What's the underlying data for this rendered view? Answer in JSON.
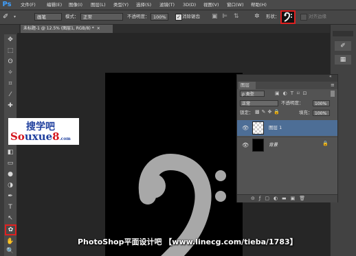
{
  "app": {
    "logo": "Ps"
  },
  "menu": [
    "文件(F)",
    "编辑(E)",
    "图像(I)",
    "图层(L)",
    "类型(Y)",
    "选择(S)",
    "滤镜(T)",
    "3D(D)",
    "视图(V)",
    "窗口(W)",
    "帮助(H)"
  ],
  "options": {
    "mode_value": "画笔",
    "mode_label": "模式：",
    "blend_value": "正常",
    "opacity_label": "不透明度：",
    "opacity_value": "100%",
    "erase_label": "消除锯齿",
    "shape_label": "形状：",
    "align_label": "对齐边缘"
  },
  "document": {
    "tab_label": "未标题-1 @ 12.5% (图层1, RGB/8) *",
    "tab_close": "×"
  },
  "layers_panel": {
    "title": "图层",
    "filter_value": "ρ 类型",
    "blend_value": "正常",
    "opacity_label": "不透明度：",
    "opacity_value": "100%",
    "lock_label": "锁定：",
    "fill_label": "填充：",
    "fill_value": "100%",
    "layers": [
      {
        "name": "图层 1",
        "selected": true
      },
      {
        "name": "背景",
        "selected": false,
        "locked": true
      }
    ],
    "footer_icons": [
      "link-icon",
      "fx-icon",
      "mask-icon",
      "adjustment-icon",
      "folder-icon",
      "new-layer-icon",
      "trash-icon"
    ]
  },
  "watermark": {
    "cn": "搜学吧",
    "en_a": "So",
    "en_b": "uxue",
    "en_c": "8",
    "en_d": ".com"
  },
  "banner": "PhotoShop平面设计吧 【www.linecg.com/tieba/1783】",
  "colors": {
    "accent_red": "#e02020",
    "layer_selected": "#4d6e96",
    "glyph": "#a8a8a8"
  }
}
